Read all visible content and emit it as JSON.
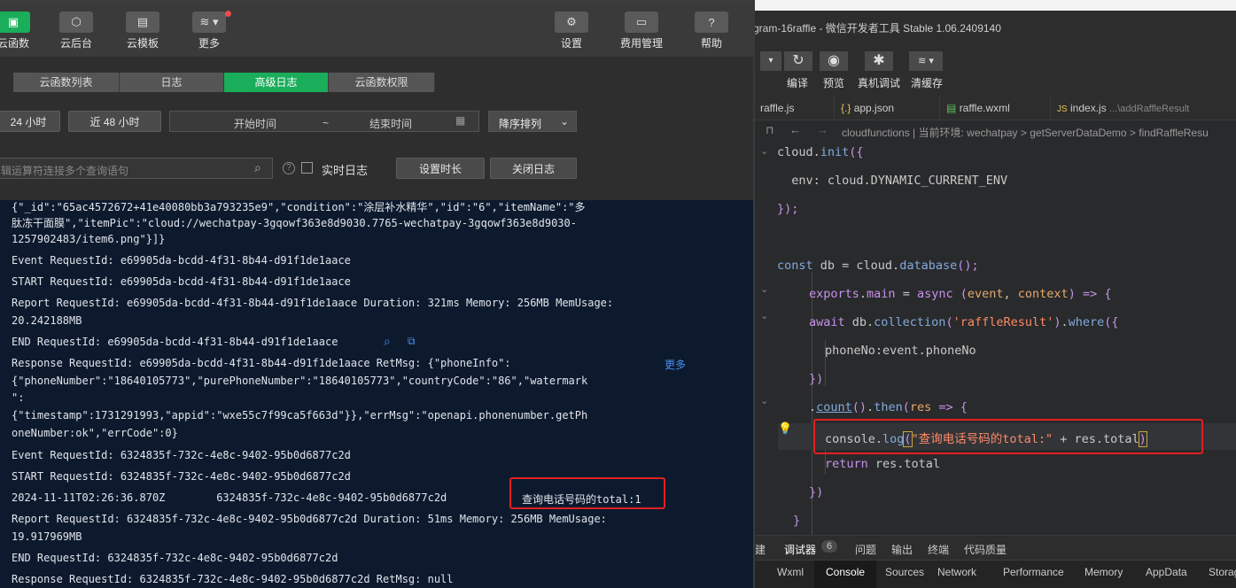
{
  "toolbar": {
    "items": [
      {
        "label": "云函数",
        "icon": "cloud-function-icon"
      },
      {
        "label": "云后台",
        "icon": "cube-icon"
      },
      {
        "label": "云模板",
        "icon": "template-icon"
      },
      {
        "label": "更多",
        "icon": "layers-icon"
      },
      {
        "label": "设置",
        "icon": "gear-icon"
      },
      {
        "label": "费用管理",
        "icon": "card-icon"
      },
      {
        "label": "帮助",
        "icon": "help-icon"
      }
    ]
  },
  "tabs": [
    "云函数列表",
    "日志",
    "高级日志",
    "云函数权限"
  ],
  "active_tab": "高级日志",
  "filters": {
    "btn_24h": "24 小时",
    "btn_48h": "近 48 小时",
    "start_time": "开始时间",
    "tilde": "~",
    "end_time": "结束时间",
    "sort": "降序排列",
    "query_placeholder": "辑运算符连接多个查询语句",
    "realtime_label": "实时日志",
    "set_duration": "设置时长",
    "close_log": "关闭日志"
  },
  "log_lines": [
    "{\"_id\":\"65ac4572672+41e40080bb3a793235e9\",\"condition\":\"涂层补水精华\",\"id\":\"6\",\"itemName\":\"多",
    "肽冻干面膜\",\"itemPic\":\"cloud://wechatpay-3gqowf363e8d9030.7765-wechatpay-3gqowf363e8d9030-",
    "1257902483/item6.png\"}]}",
    "Event RequestId: e69905da-bcdd-4f31-8b44-d91f1de1aace",
    "START RequestId: e69905da-bcdd-4f31-8b44-d91f1de1aace",
    "Report RequestId: e69905da-bcdd-4f31-8b44-d91f1de1aace Duration: 321ms Memory: 256MB MemUsage:",
    "20.242188MB",
    "END RequestId: e69905da-bcdd-4f31-8b44-d91f1de1aace",
    "Response RequestId: e69905da-bcdd-4f31-8b44-d91f1de1aace RetMsg: {\"phoneInfo\":",
    "{\"phoneNumber\":\"18640105773\",\"purePhoneNumber\":\"18640105773\",\"countryCode\":\"86\",\"watermark",
    "\":",
    "{\"timestamp\":1731291993,\"appid\":\"wxe55c7f99ca5f663d\"}},\"errMsg\":\"openapi.phonenumber.getPh",
    "oneNumber:ok\",\"errCode\":0}",
    "Event RequestId: 6324835f-732c-4e8c-9402-95b0d6877c2d",
    "START RequestId: 6324835f-732c-4e8c-9402-95b0d6877c2d",
    "2024-11-11T02:26:36.870Z        6324835f-732c-4e8c-9402-95b0d6877c2d",
    "Report RequestId: 6324835f-732c-4e8c-9402-95b0d6877c2d Duration: 51ms Memory: 256MB MemUsage:",
    "19.917969MB",
    "END RequestId: 6324835f-732c-4e8c-9402-95b0d6877c2d",
    "Response RequestId: 6324835f-732c-4e8c-9402-95b0d6877c2d RetMsg: null"
  ],
  "more_link": "更多",
  "highlight_output": "查询电话号码的total:1",
  "window_title": "gram-16raffle - 微信开发者工具 Stable 1.06.2409140",
  "right_toolbar": {
    "items": [
      "编译",
      "预览",
      "真机调试",
      "清缓存"
    ]
  },
  "file_tabs": [
    "raffle.js",
    "app.json",
    "raffle.wxml",
    "index.js"
  ],
  "file_tab_hint": "...\\addRaffleResult",
  "breadcrumb": "cloudfunctions | 当前环境: wechatpay > getServerDataDemo > findRaffleResu",
  "code_lines": [
    "cloud.init({",
    "  env: cloud.DYNAMIC_CURRENT_ENV",
    "});",
    "",
    "const db = cloud.database();",
    "exports.main = async (event, context) => {",
    "await db.collection('raffleResult').where({",
    "phoneNo:event.phoneNo",
    "})",
    ".count().then(res => {",
    "console.log(\"查询电话号码的total:\" + res.total)",
    "return res.total",
    "})",
    "}"
  ],
  "devtools": {
    "top_tabs": [
      "建",
      "调试器",
      "问题",
      "输出",
      "终端",
      "代码质量"
    ],
    "badge": "6",
    "panel_tabs": [
      "Wxml",
      "Console",
      "Sources",
      "Network",
      "Performance",
      "Memory",
      "AppData",
      "Storag"
    ]
  }
}
